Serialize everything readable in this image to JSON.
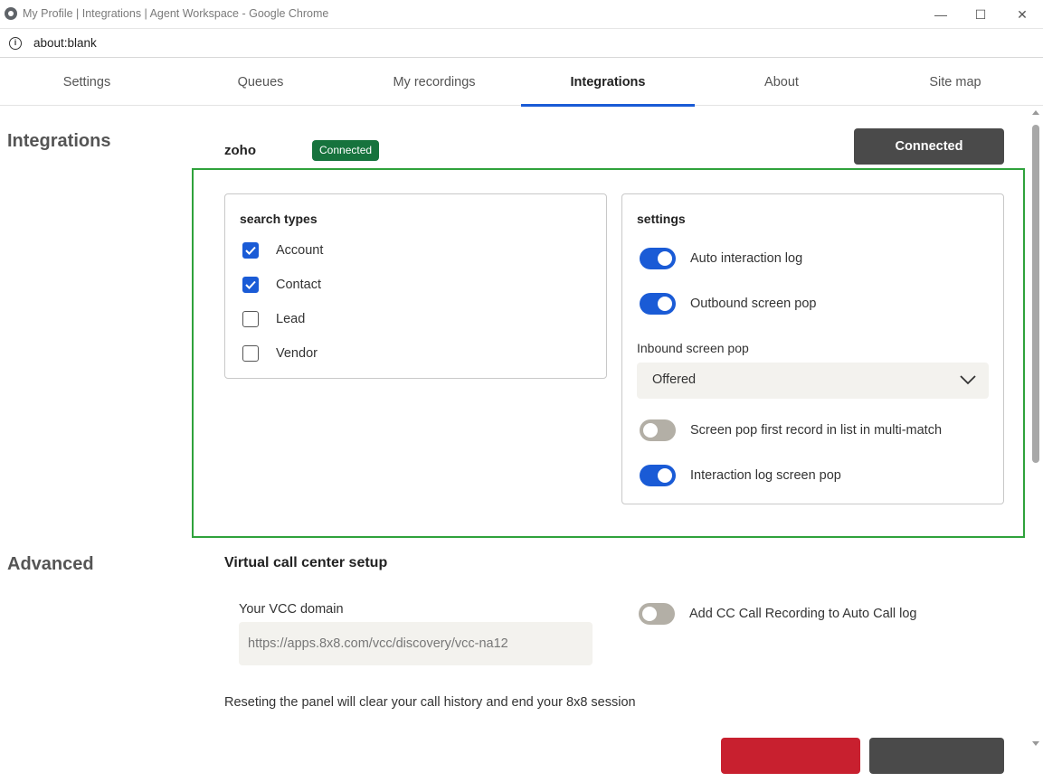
{
  "window": {
    "title": "My Profile | Integrations | Agent Workspace - Google Chrome",
    "minimize": "—",
    "maximize": "☐",
    "close": "✕"
  },
  "address_bar": {
    "url": "about:blank",
    "info_glyph": "i"
  },
  "tabs": [
    {
      "label": "Settings"
    },
    {
      "label": "Queues"
    },
    {
      "label": "My recordings"
    },
    {
      "label": "Integrations",
      "active": true
    },
    {
      "label": "About"
    },
    {
      "label": "Site map"
    }
  ],
  "integrations": {
    "section_title": "Integrations",
    "provider": "zoho",
    "status_badge": "Connected",
    "connect_button": "Connected",
    "search_types": {
      "title": "search types",
      "items": [
        {
          "label": "Account",
          "checked": true
        },
        {
          "label": "Contact",
          "checked": true
        },
        {
          "label": "Lead",
          "checked": false
        },
        {
          "label": "Vendor",
          "checked": false
        }
      ]
    },
    "settings": {
      "title": "settings",
      "auto_interaction_log": {
        "label": "Auto interaction log",
        "on": true
      },
      "outbound_screen_pop": {
        "label": "Outbound screen pop",
        "on": true
      },
      "inbound_screen_pop_label": "Inbound screen pop",
      "inbound_screen_pop_value": "Offered",
      "screen_pop_first_record": {
        "label": "Screen pop first record in list in multi-match",
        "on": false
      },
      "interaction_log_screen_pop": {
        "label": "Interaction log screen pop",
        "on": true
      }
    }
  },
  "advanced": {
    "section_title": "Advanced",
    "vcc_title": "Virtual call center setup",
    "vcc_domain_label": "Your VCC domain",
    "vcc_domain_value": "https://apps.8x8.com/vcc/discovery/vcc-na12",
    "cc_recording": {
      "label": "Add CC Call Recording to Auto Call log",
      "on": false
    },
    "reset_text": "Reseting the panel will clear your call history and end your 8x8 session"
  },
  "colors": {
    "accent": "#1a5bd6",
    "connected_green": "#16733d",
    "frame_green": "#2fa23c",
    "danger": "#c8202f",
    "dark_button": "#4a4a4a"
  }
}
